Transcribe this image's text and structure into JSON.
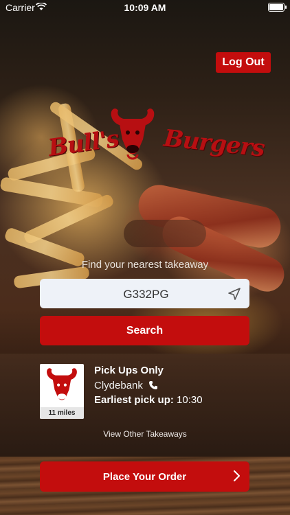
{
  "status_bar": {
    "carrier": "Carrier",
    "time": "10:09 AM"
  },
  "header": {
    "logout_label": "Log Out"
  },
  "logo": {
    "text_left": "Bull's",
    "text_right": "Burgers"
  },
  "search": {
    "prompt": "Find your nearest takeaway",
    "postcode_value": "G332PG",
    "button_label": "Search"
  },
  "store": {
    "title": "Pick Ups Only",
    "town": "Clydebank",
    "pickup_label": "Earliest pick up:",
    "pickup_time": "10:30",
    "distance": "11 miles"
  },
  "links": {
    "view_other": "View Other Takeaways"
  },
  "order": {
    "button_label": "Place Your Order"
  },
  "colors": {
    "brand_red": "#c30d0d"
  },
  "icons": [
    "wifi-icon",
    "battery-icon",
    "bull-logo-icon",
    "location-arrow-icon",
    "phone-icon",
    "chevron-right-icon"
  ]
}
